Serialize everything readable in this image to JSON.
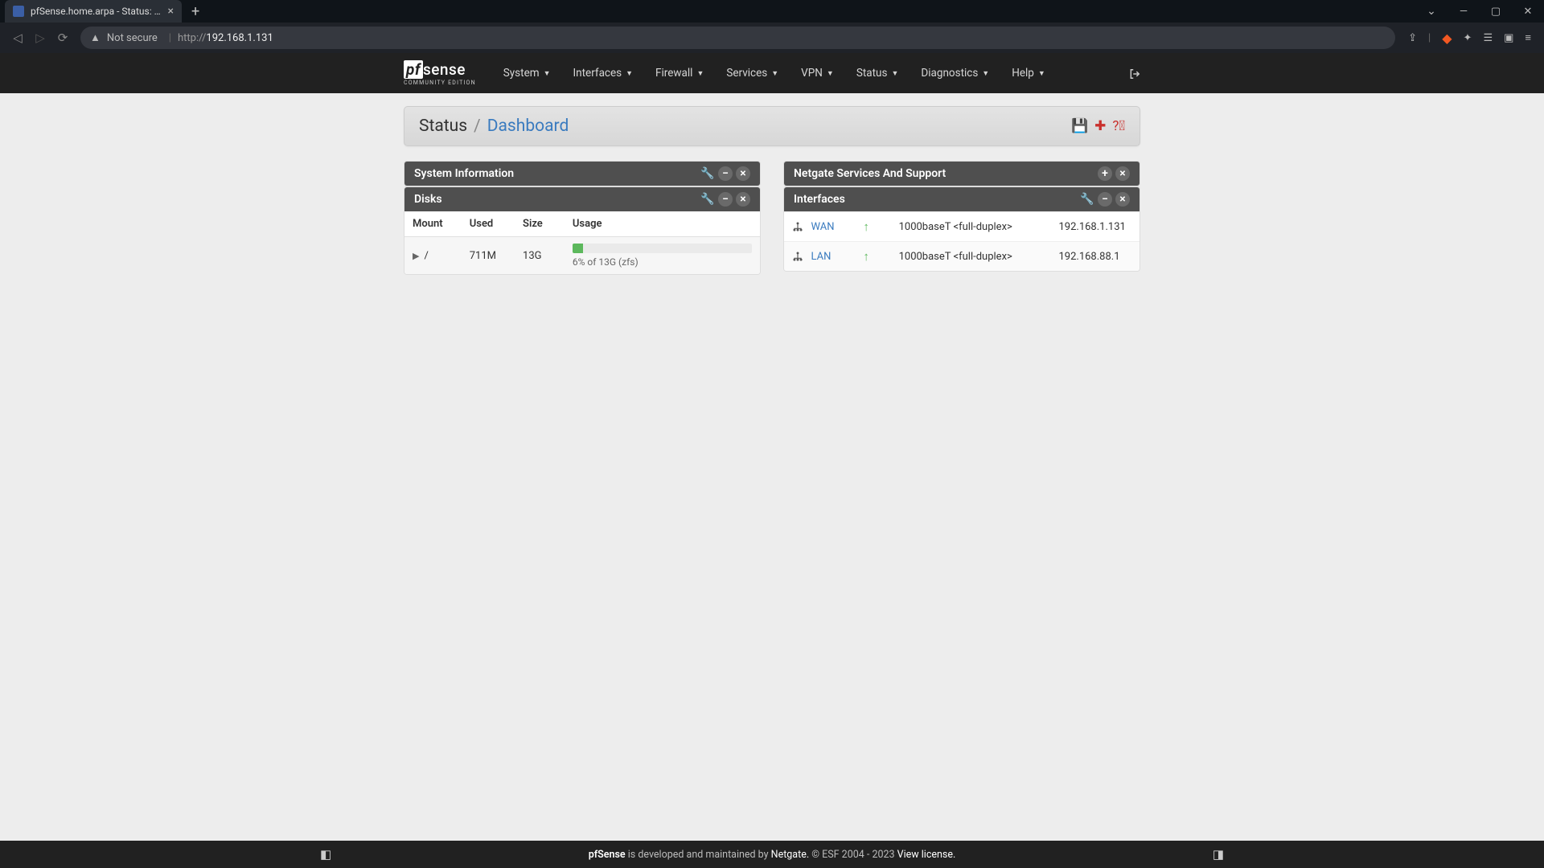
{
  "browser": {
    "tab_title": "pfSense.home.arpa - Status: Dash",
    "not_secure": "Not secure",
    "url_proto": "http://",
    "url_host": "192.168.1.131"
  },
  "logo": {
    "main_pf": "pf",
    "main_sense": "sense",
    "sub": "COMMUNITY EDITION"
  },
  "nav": {
    "items": [
      "System",
      "Interfaces",
      "Firewall",
      "Services",
      "VPN",
      "Status",
      "Diagnostics",
      "Help"
    ]
  },
  "breadcrumb": {
    "a": "Status",
    "b": "Dashboard"
  },
  "panels": {
    "sysinfo_title": "System Information",
    "netgate_title": "Netgate Services And Support",
    "disks_title": "Disks",
    "interfaces_title": "Interfaces"
  },
  "disks": {
    "headers": [
      "Mount",
      "Used",
      "Size",
      "Usage"
    ],
    "rows": [
      {
        "mount": "/",
        "used": "711M",
        "size": "13G",
        "usage_pct": 6,
        "usage_text": "6% of 13G (zfs)"
      }
    ]
  },
  "interfaces": {
    "rows": [
      {
        "name": "WAN",
        "status": "up",
        "media": "1000baseT <full-duplex>",
        "addr": "192.168.1.131"
      },
      {
        "name": "LAN",
        "status": "up",
        "media": "1000baseT <full-duplex>",
        "addr": "192.168.88.1"
      }
    ]
  },
  "footer": {
    "brand": "pfSense",
    "text1": " is developed and maintained by ",
    "netgate": "Netgate.",
    "text2": " © ESF 2004 - 2023 ",
    "license": "View license."
  }
}
